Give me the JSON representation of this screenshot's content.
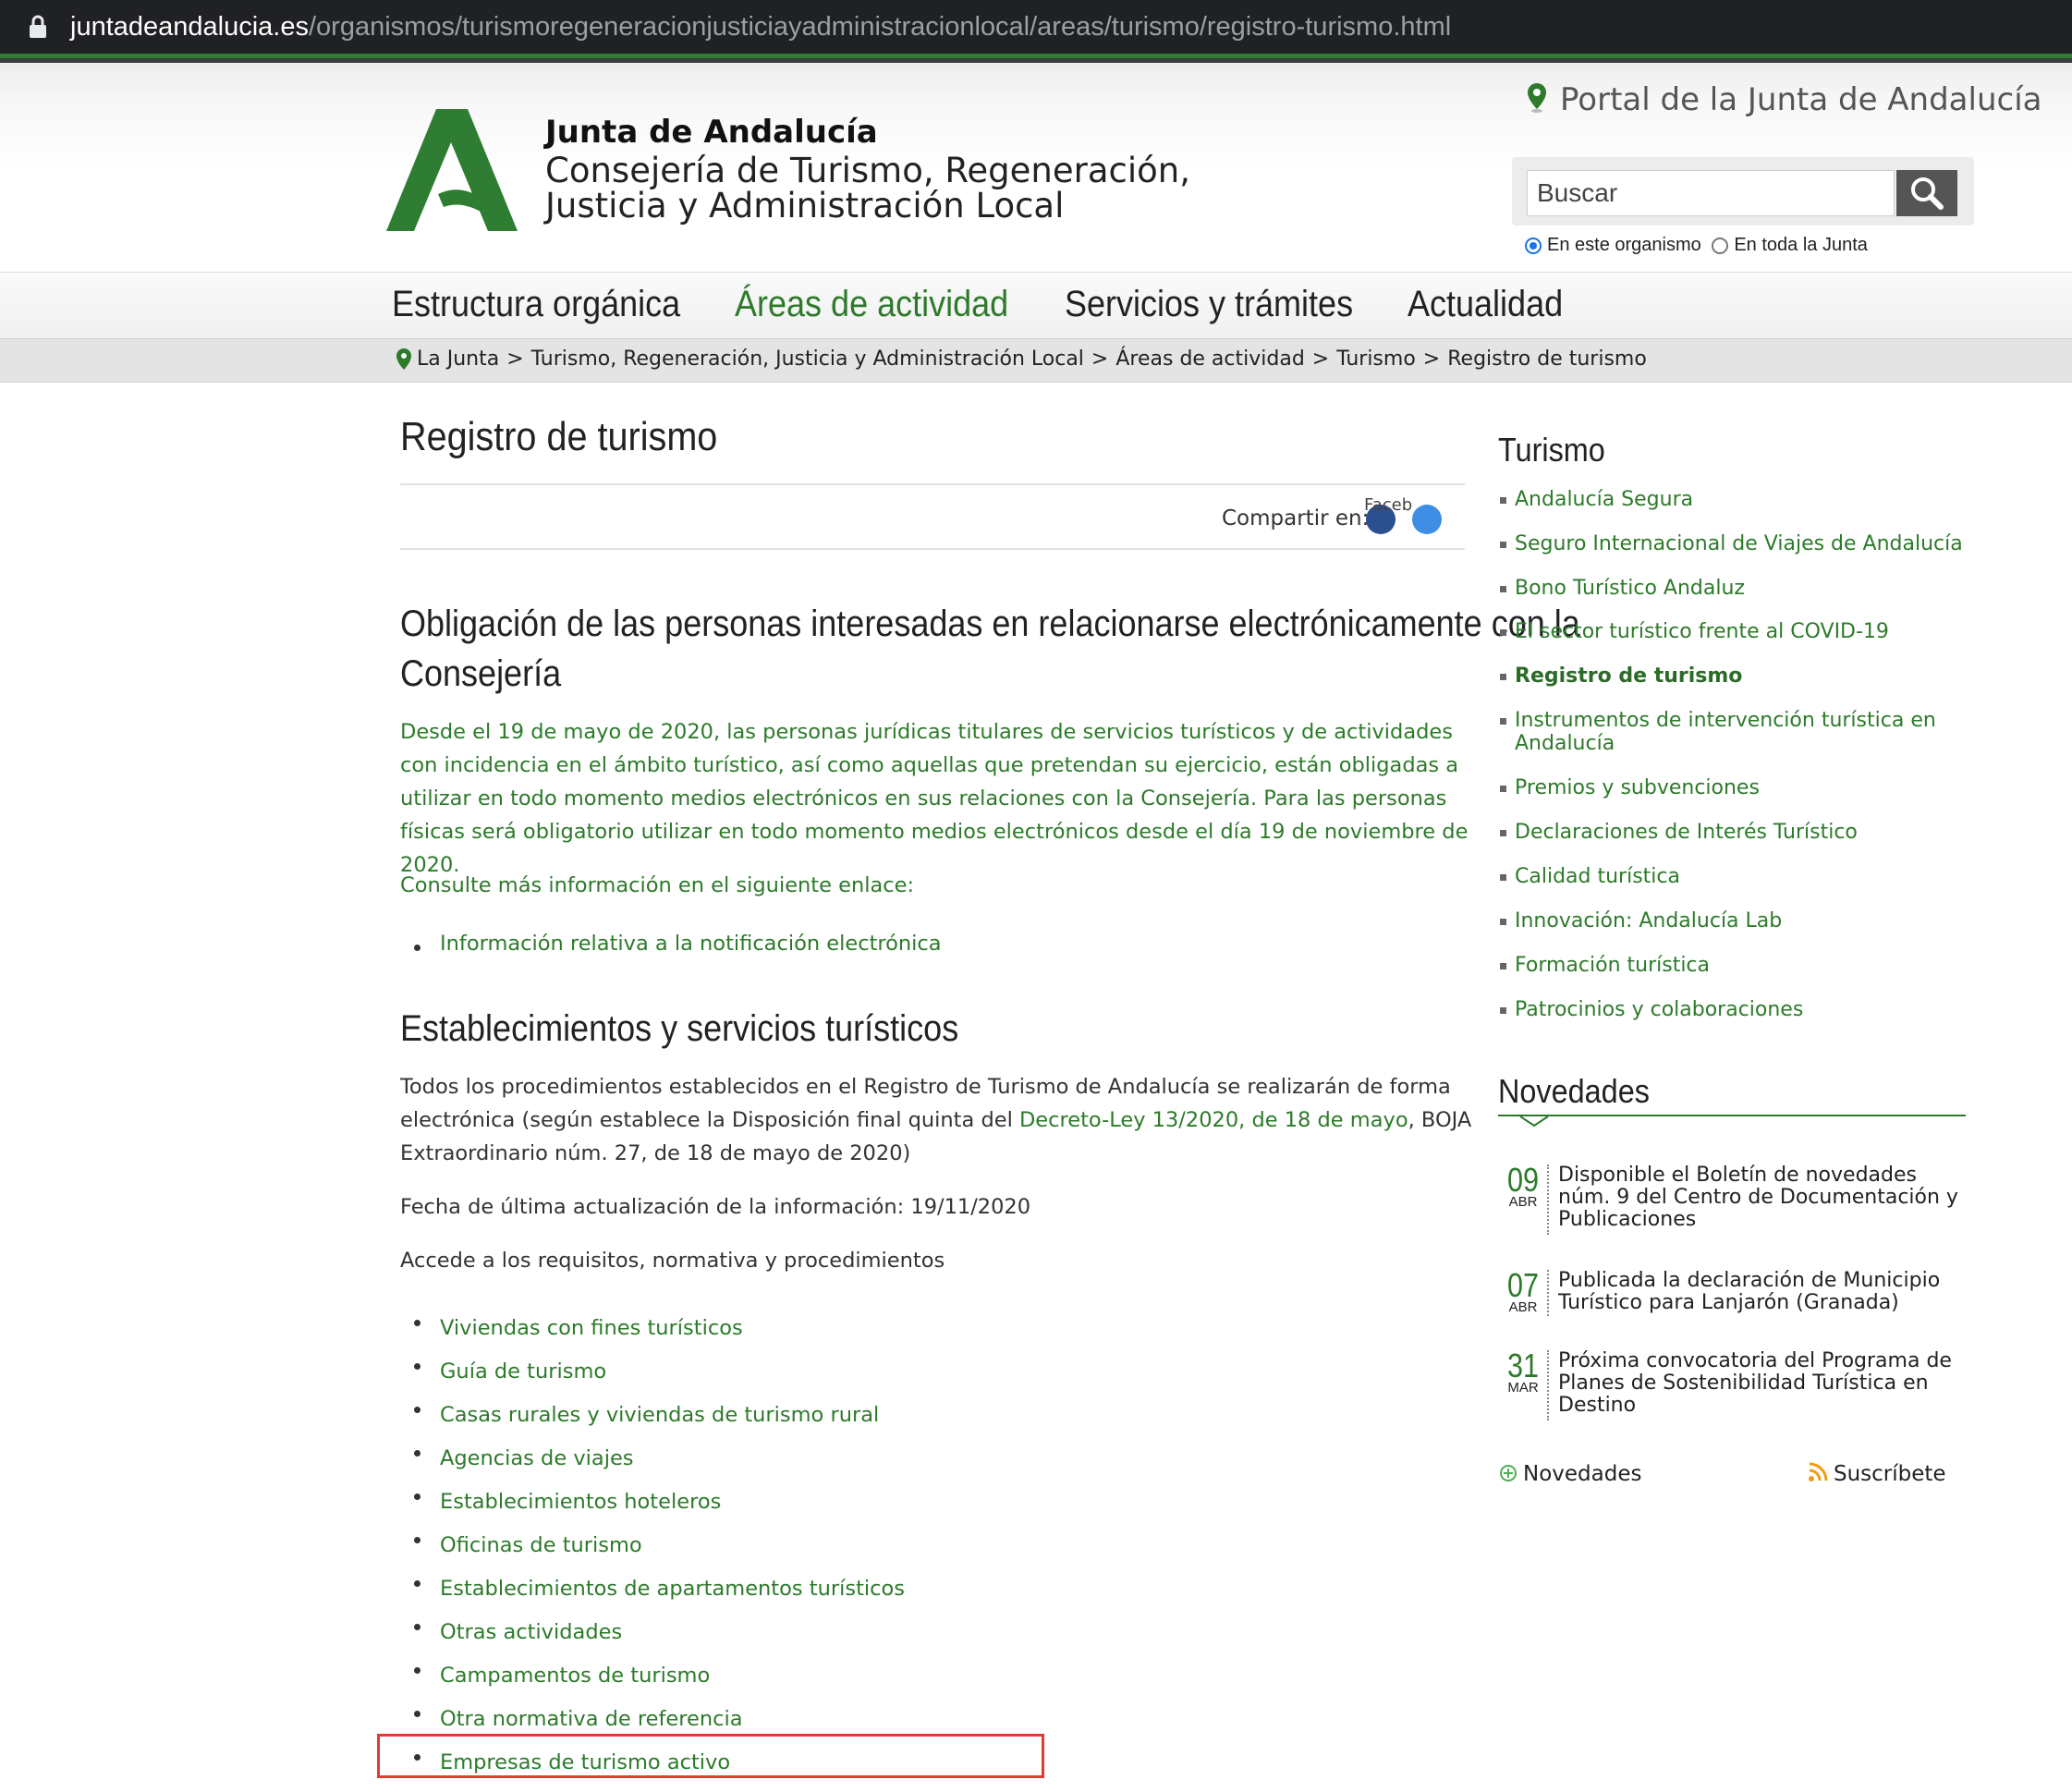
{
  "browser": {
    "url_domain": "juntadeandalucia.es",
    "url_path": "/organismos/turismoregeneracionjusticiayadministracionlocal/areas/turismo/registro-turismo.html"
  },
  "header": {
    "org_title": "Junta de Andalucía",
    "org_subtitle_line1": "Consejería de Turismo, Regeneración,",
    "org_subtitle_line2": "Justicia y Administración Local",
    "portal_link": "Portal de la Junta de Andalucía",
    "search_placeholder": "Buscar",
    "scope_option_1": "En este organismo",
    "scope_option_2": "En toda la Junta"
  },
  "nav": {
    "items": [
      {
        "label": "Estructura orgánica"
      },
      {
        "label": "Áreas de actividad"
      },
      {
        "label": "Servicios y trámites"
      },
      {
        "label": "Actualidad"
      }
    ]
  },
  "breadcrumb": {
    "items": [
      "La Junta",
      "Turismo, Regeneración, Justicia y Administración Local",
      "Áreas de actividad",
      "Turismo",
      "Registro de turismo"
    ],
    "separator": ">"
  },
  "content": {
    "title": "Registro de turismo",
    "share_label": "Compartir en:",
    "share_fb_alt": "Faceb",
    "section1_title_line1": "Obligación de las personas interesadas en relacionarse electrónicamente con la",
    "section1_title_line2": "Consejería",
    "section1_para": "Desde el 19 de mayo de 2020, las personas jurídicas titulares de servicios turísticos y de actividades con incidencia en el ámbito turístico, así como aquellas que pretendan su ejercicio, están obligadas a utilizar en todo momento medios electrónicos en sus relaciones con la Consejería. Para las personas físicas será obligatorio utilizar en todo momento medios electrónicos desde el día 19 de noviembre de 2020.",
    "section1_consult": "Consulte más información en el siguiente enlace:",
    "section1_link": "Información relativa a la notificación electrónica",
    "section2_title": "Establecimientos y servicios turísticos",
    "section2_para_start": "Todos los procedimientos establecidos en el Registro de Turismo de Andalucía se realizarán de forma electrónica (según establece la Disposición final quinta del ",
    "section2_para_link": "Decreto-Ley 13/2020, de 18 de mayo",
    "section2_para_end": ", BOJA Extraordinario núm. 27, de 18 de mayo de 2020)",
    "section2_updated": "Fecha de última actualización de la información: 19/11/2020",
    "section2_access": "Accede a los requisitos, normativa y procedimientos",
    "section2_links": [
      "Viviendas con fines turísticos",
      "Guía de turismo",
      "Casas rurales y viviendas de turismo rural",
      "Agencias de viajes",
      "Establecimientos hoteleros",
      "Oficinas de turismo",
      "Establecimientos de apartamentos turísticos",
      "Otras actividades",
      "Campamentos de turismo",
      "Otra normativa de referencia",
      "Empresas de turismo activo"
    ]
  },
  "sidebar": {
    "title": "Turismo",
    "items": [
      "Andalucía Segura",
      "Seguro Internacional de Viajes de Andalucía",
      "Bono Turístico Andaluz",
      "El sector turístico frente al COVID-19",
      "Registro de turismo",
      "Instrumentos de intervención turística en Andalucía",
      "Premios y subvenciones",
      "Declaraciones de Interés Turístico",
      "Calidad turística",
      "Innovación: Andalucía Lab",
      "Formación turística",
      "Patrocinios y colaboraciones"
    ],
    "news_title": "Novedades",
    "news": [
      {
        "day": "09",
        "month": "ABR",
        "text": "Disponible el Boletín de novedades núm. 9 del Centro de Documentación y Publicaciones"
      },
      {
        "day": "07",
        "month": "ABR",
        "text": "Publicada la declaración de Municipio Turístico para Lanjarón (Granada)"
      },
      {
        "day": "31",
        "month": "MAR",
        "text": "Próxima convocatoria del Programa de Planes de Sostenibilidad Turística en Destino"
      }
    ],
    "footer_news": "Novedades",
    "footer_subscribe": "Suscríbete"
  },
  "colors": {
    "brand_green": "#2d7a2a",
    "highlight_red": "#e53935"
  }
}
